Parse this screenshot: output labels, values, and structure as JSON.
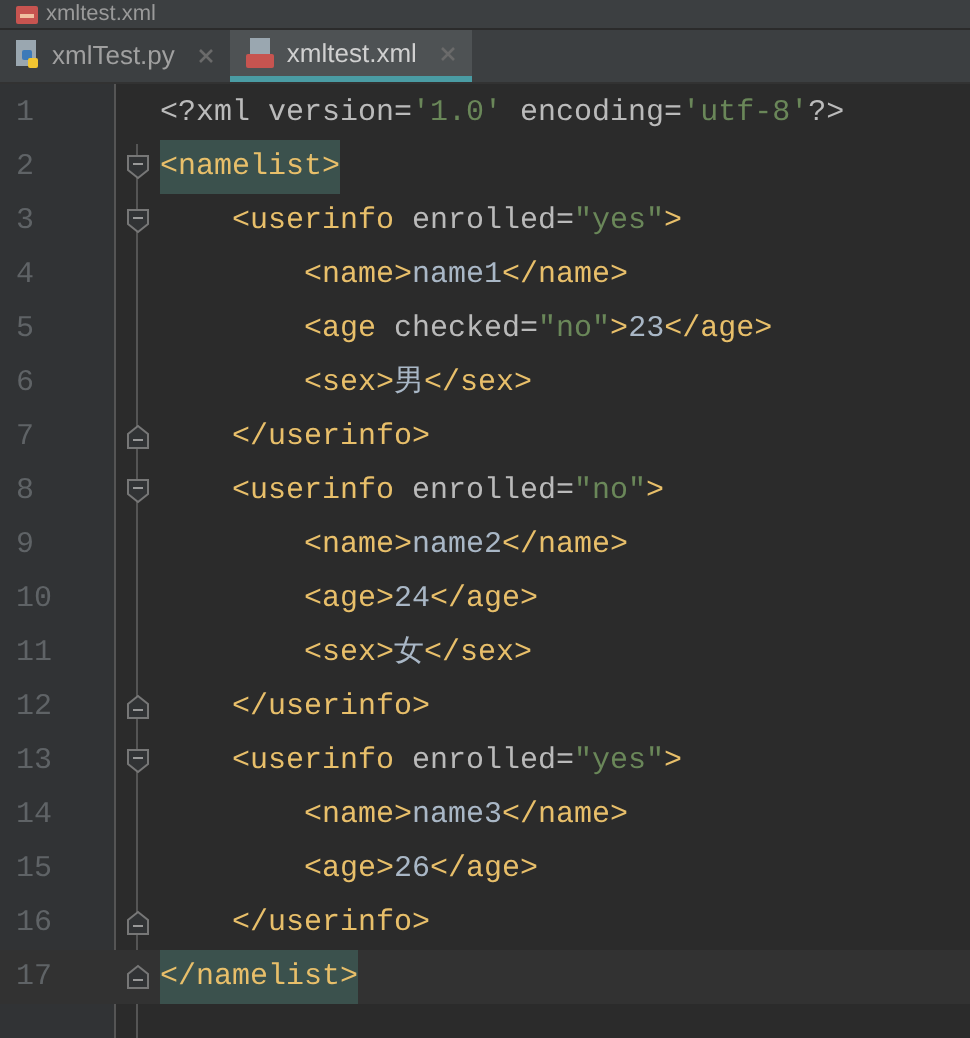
{
  "window": {
    "title": "xmltest.xml"
  },
  "tabs": [
    {
      "label": "xmlTest.py",
      "kind": "python",
      "selected": false
    },
    {
      "label": "xmltest.xml",
      "kind": "xml",
      "selected": true
    }
  ],
  "editor": {
    "lines": [
      {
        "number": "1",
        "current": false,
        "tokens": [
          {
            "kind": "prolog",
            "text": "<?xml version="
          },
          {
            "kind": "value",
            "text": "'1.0'"
          },
          {
            "kind": "prolog",
            "text": " encoding="
          },
          {
            "kind": "value",
            "text": "'utf-8'"
          },
          {
            "kind": "prolog",
            "text": "?>"
          }
        ]
      },
      {
        "number": "2",
        "kind": "fold_start",
        "current": false,
        "tokens": [
          {
            "kind": "tag",
            "text": "<namelist>",
            "matched": true
          }
        ],
        "children": [
          {
            "number": "3",
            "kind": "fold_start",
            "current": false,
            "tokens": [
              {
                "kind": "tag",
                "text": "<userinfo"
              },
              {
                "kind": "attr",
                "text": " enrolled="
              },
              {
                "kind": "value",
                "text": "\"yes\""
              },
              {
                "kind": "tag",
                "text": ">"
              }
            ],
            "children": [
              {
                "number": "4",
                "current": false,
                "tokens": [
                  {
                    "kind": "tag",
                    "text": "<name>"
                  },
                  {
                    "kind": "text",
                    "text": "name1"
                  },
                  {
                    "kind": "tag",
                    "text": "</name>"
                  }
                ]
              },
              {
                "number": "5",
                "current": false,
                "tokens": [
                  {
                    "kind": "tag",
                    "text": "<age"
                  },
                  {
                    "kind": "attr",
                    "text": " checked="
                  },
                  {
                    "kind": "value",
                    "text": "\"no\""
                  },
                  {
                    "kind": "tag",
                    "text": ">"
                  },
                  {
                    "kind": "text",
                    "text": "23"
                  },
                  {
                    "kind": "tag",
                    "text": "</age>"
                  }
                ]
              },
              {
                "number": "6",
                "current": false,
                "tokens": [
                  {
                    "kind": "tag",
                    "text": "<sex>"
                  },
                  {
                    "kind": "text",
                    "text": "男"
                  },
                  {
                    "kind": "tag",
                    "text": "</sex>"
                  }
                ]
              }
            ]
          },
          {
            "number": "7",
            "kind": "fold_end",
            "current": false,
            "tokens": [
              {
                "kind": "tag",
                "text": "</userinfo>"
              }
            ]
          },
          {
            "number": "8",
            "kind": "fold_start",
            "current": false,
            "tokens": [
              {
                "kind": "tag",
                "text": "<userinfo"
              },
              {
                "kind": "attr",
                "text": " enrolled="
              },
              {
                "kind": "value",
                "text": "\"no\""
              },
              {
                "kind": "tag",
                "text": ">"
              }
            ],
            "children": [
              {
                "number": "9",
                "current": false,
                "tokens": [
                  {
                    "kind": "tag",
                    "text": "<name>"
                  },
                  {
                    "kind": "text",
                    "text": "name2"
                  },
                  {
                    "kind": "tag",
                    "text": "</name>"
                  }
                ]
              },
              {
                "number": "10",
                "current": false,
                "tokens": [
                  {
                    "kind": "tag",
                    "text": "<age>"
                  },
                  {
                    "kind": "text",
                    "text": "24"
                  },
                  {
                    "kind": "tag",
                    "text": "</age>"
                  }
                ]
              },
              {
                "number": "11",
                "current": false,
                "tokens": [
                  {
                    "kind": "tag",
                    "text": "<sex>"
                  },
                  {
                    "kind": "text",
                    "text": "女"
                  },
                  {
                    "kind": "tag",
                    "text": "</sex>"
                  }
                ]
              }
            ]
          },
          {
            "number": "12",
            "kind": "fold_end",
            "current": false,
            "tokens": [
              {
                "kind": "tag",
                "text": "</userinfo>"
              }
            ]
          },
          {
            "number": "13",
            "kind": "fold_start",
            "current": false,
            "tokens": [
              {
                "kind": "tag",
                "text": "<userinfo"
              },
              {
                "kind": "attr",
                "text": " enrolled="
              },
              {
                "kind": "value",
                "text": "\"yes\""
              },
              {
                "kind": "tag",
                "text": ">"
              }
            ],
            "children": [
              {
                "number": "14",
                "current": false,
                "tokens": [
                  {
                    "kind": "tag",
                    "text": "<name>"
                  },
                  {
                    "kind": "text",
                    "text": "name3"
                  },
                  {
                    "kind": "tag",
                    "text": "</name>"
                  }
                ]
              },
              {
                "number": "15",
                "current": false,
                "tokens": [
                  {
                    "kind": "tag",
                    "text": "<age>"
                  },
                  {
                    "kind": "text",
                    "text": "26"
                  },
                  {
                    "kind": "tag",
                    "text": "</age>"
                  }
                ]
              }
            ]
          },
          {
            "number": "16",
            "kind": "fold_end",
            "current": false,
            "tokens": [
              {
                "kind": "tag",
                "text": "</userinfo>"
              }
            ]
          }
        ]
      },
      {
        "number": "17",
        "kind": "fold_end",
        "current": true,
        "tokens": [
          {
            "kind": "tag",
            "text": "</namelist>",
            "matched": true
          }
        ]
      }
    ]
  }
}
